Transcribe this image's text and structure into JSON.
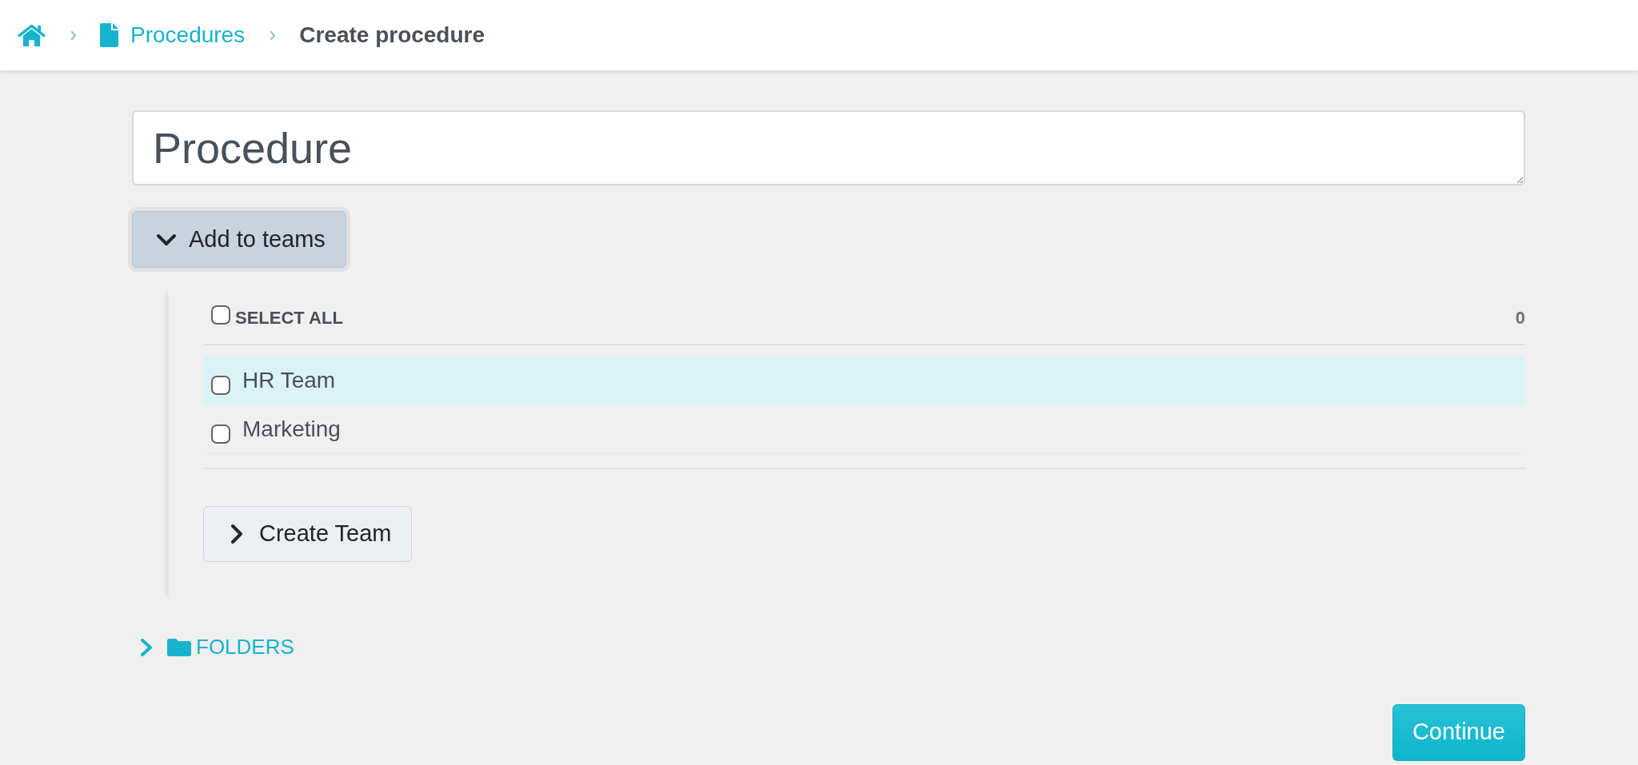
{
  "breadcrumb": [
    {
      "kind": "home"
    },
    {
      "kind": "link",
      "label": "Procedures"
    },
    {
      "kind": "current",
      "label": "Create procedure"
    }
  ],
  "title_field": {
    "value": "Procedure"
  },
  "teams_toggle": {
    "label": "Add to teams",
    "expanded": true,
    "focused": true
  },
  "teams": {
    "select_all": {
      "label": "SELECT ALL",
      "checked": false
    },
    "count": "0",
    "items": [
      {
        "name": "HR Team",
        "checked": false,
        "hovered": true
      },
      {
        "name": "Marketing",
        "checked": false,
        "hovered": false
      }
    ],
    "create_button": {
      "label": "Create Team",
      "expanded": false
    }
  },
  "folders": {
    "label": "FOLDERS",
    "expanded": false
  },
  "continue_button": {
    "label": "Continue"
  }
}
